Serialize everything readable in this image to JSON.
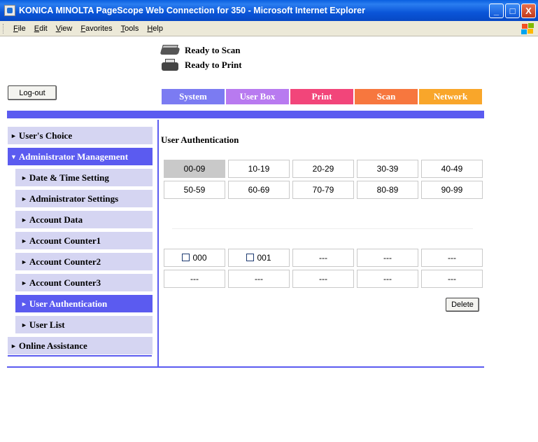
{
  "window": {
    "title": "KONICA MINOLTA PageScope Web Connection for 350 - Microsoft Internet Explorer",
    "minimize_label": "_",
    "maximize_label": "□",
    "close_label": "X"
  },
  "menu": [
    "File",
    "Edit",
    "View",
    "Favorites",
    "Tools",
    "Help"
  ],
  "status": {
    "scan": "Ready to Scan",
    "print": "Ready to Print"
  },
  "logout_label": "Log-out",
  "tabs": [
    {
      "label": "System",
      "color": "#7b7bf2"
    },
    {
      "label": "User Box",
      "color": "#b87af0"
    },
    {
      "label": "Print",
      "color": "#f2457a"
    },
    {
      "label": "Scan",
      "color": "#f7773e"
    },
    {
      "label": "Network",
      "color": "#f9a62a"
    }
  ],
  "sidebar": {
    "items": [
      {
        "label": "User's Choice",
        "arrow": "►"
      },
      {
        "label": "Administrator Management",
        "arrow": "▼"
      },
      {
        "label": "Date & Time Setting",
        "arrow": "►"
      },
      {
        "label": "Administrator Settings",
        "arrow": "►"
      },
      {
        "label": "Account Data",
        "arrow": "►"
      },
      {
        "label": "Account Counter1",
        "arrow": "►"
      },
      {
        "label": "Account Counter2",
        "arrow": "►"
      },
      {
        "label": "Account Counter3",
        "arrow": "►"
      },
      {
        "label": "User Authentication",
        "arrow": "►"
      },
      {
        "label": "User List",
        "arrow": "►"
      },
      {
        "label": "Online Assistance",
        "arrow": "►"
      }
    ]
  },
  "main": {
    "title": "User Authentication",
    "ranges": [
      "00-09",
      "10-19",
      "20-29",
      "30-39",
      "40-49",
      "50-59",
      "60-69",
      "70-79",
      "80-89",
      "90-99"
    ],
    "selected_range": "00-09",
    "users": [
      "000",
      "001",
      "---",
      "---",
      "---",
      "---",
      "---",
      "---",
      "---",
      "---"
    ],
    "delete_label": "Delete"
  },
  "colors": {
    "accent": "#5b5bf0",
    "nav_bg": "#d5d5f2",
    "selected_cell": "#c9c9c9"
  }
}
